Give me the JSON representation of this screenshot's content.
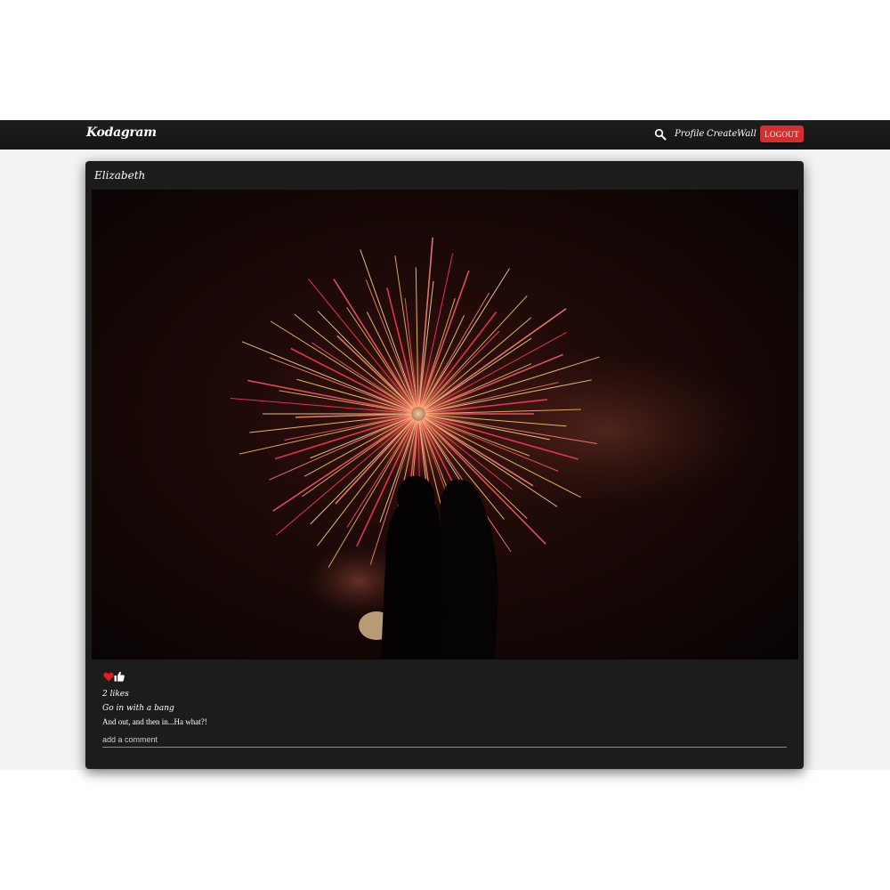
{
  "navbar": {
    "brand": "Kodagram",
    "search_icon": "search-icon",
    "links": [
      "Profile",
      "Create",
      "Wall"
    ],
    "logout_label": "LOGOUT",
    "logout_color": "#d32f2f"
  },
  "post": {
    "author": "Elizabeth",
    "image": "fireworks-couple-silhouette",
    "like_icon": "heart-icon",
    "thumb_icon": "thumbs-up-icon",
    "likes_text": "2 likes",
    "title": "Go in with a bang",
    "body": "And out, and then in...Ha what?!",
    "comment_placeholder": "add a comment"
  }
}
